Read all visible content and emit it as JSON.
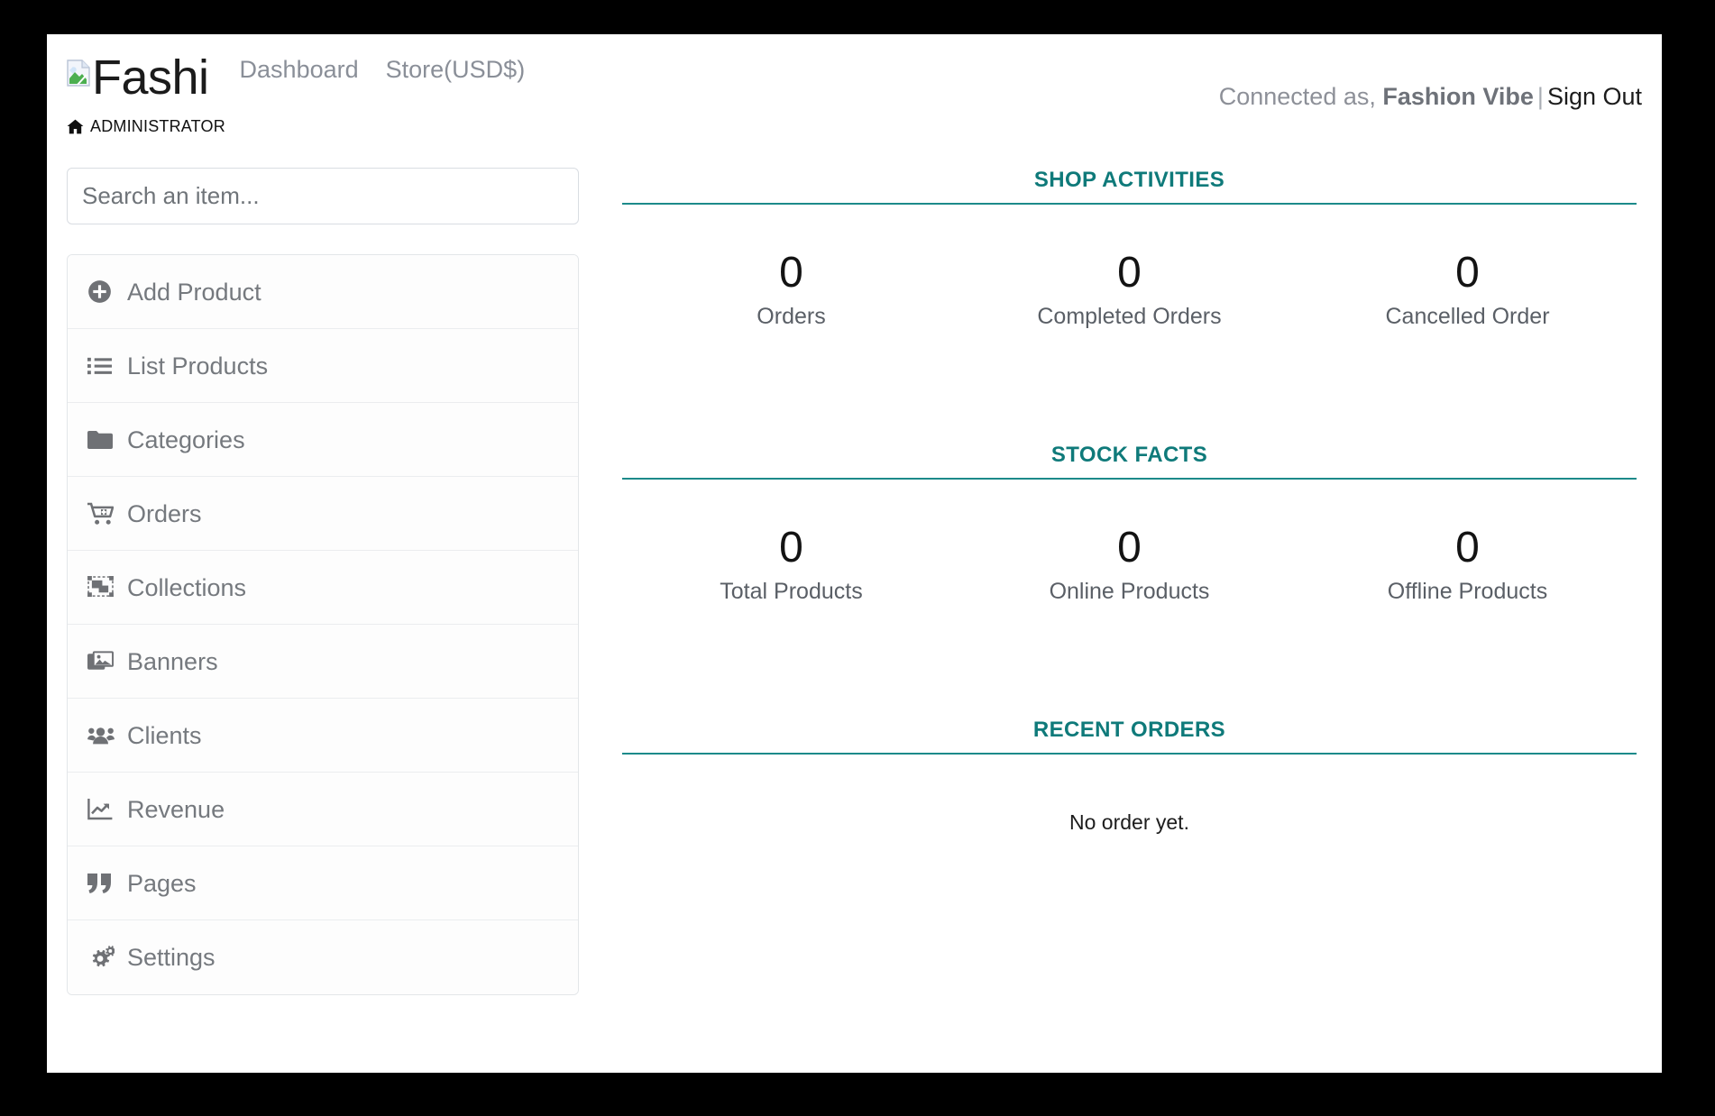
{
  "header": {
    "logo_icon": "broken-image-icon",
    "brand": "Fashi",
    "nav": [
      {
        "label": "Dashboard"
      },
      {
        "label": "Store(USD$)"
      }
    ],
    "connected_prefix": "Connected as,",
    "user_name": "Fashion Vibe",
    "separator": "|",
    "sign_out": "Sign Out",
    "breadcrumb_icon": "home-icon",
    "breadcrumb": "ADMINISTRATOR"
  },
  "sidebar": {
    "search": {
      "placeholder": "Search an item...",
      "value": ""
    },
    "items": [
      {
        "label": "Add Product",
        "icon": "plus-circle-icon"
      },
      {
        "label": "List Products",
        "icon": "list-ul-icon"
      },
      {
        "label": "Categories",
        "icon": "folder-icon"
      },
      {
        "label": "Orders",
        "icon": "cart-plus-icon"
      },
      {
        "label": "Collections",
        "icon": "object-group-icon"
      },
      {
        "label": "Banners",
        "icon": "images-icon"
      },
      {
        "label": "Clients",
        "icon": "users-icon"
      },
      {
        "label": "Revenue",
        "icon": "chart-line-icon"
      },
      {
        "label": "Pages",
        "icon": "quote-right-icon"
      },
      {
        "label": "Settings",
        "icon": "cogs-icon"
      }
    ]
  },
  "main": {
    "shop_activities": {
      "title": "SHOP ACTIVITIES",
      "stats": [
        {
          "value": "0",
          "label": "Orders"
        },
        {
          "value": "0",
          "label": "Completed Orders"
        },
        {
          "value": "0",
          "label": "Cancelled Order"
        }
      ]
    },
    "stock_facts": {
      "title": "STOCK FACTS",
      "stats": [
        {
          "value": "0",
          "label": "Total Products"
        },
        {
          "value": "0",
          "label": "Online Products"
        },
        {
          "value": "0",
          "label": "Offline Products"
        }
      ]
    },
    "recent_orders": {
      "title": "RECENT ORDERS",
      "empty_text": "No order yet."
    }
  },
  "colors": {
    "accent_teal": "#0f7a7a",
    "rule_teal": "#1c8a8a",
    "text_gray": "#75797e",
    "page_bg": "#ffffff",
    "outer_bg": "#000000"
  }
}
